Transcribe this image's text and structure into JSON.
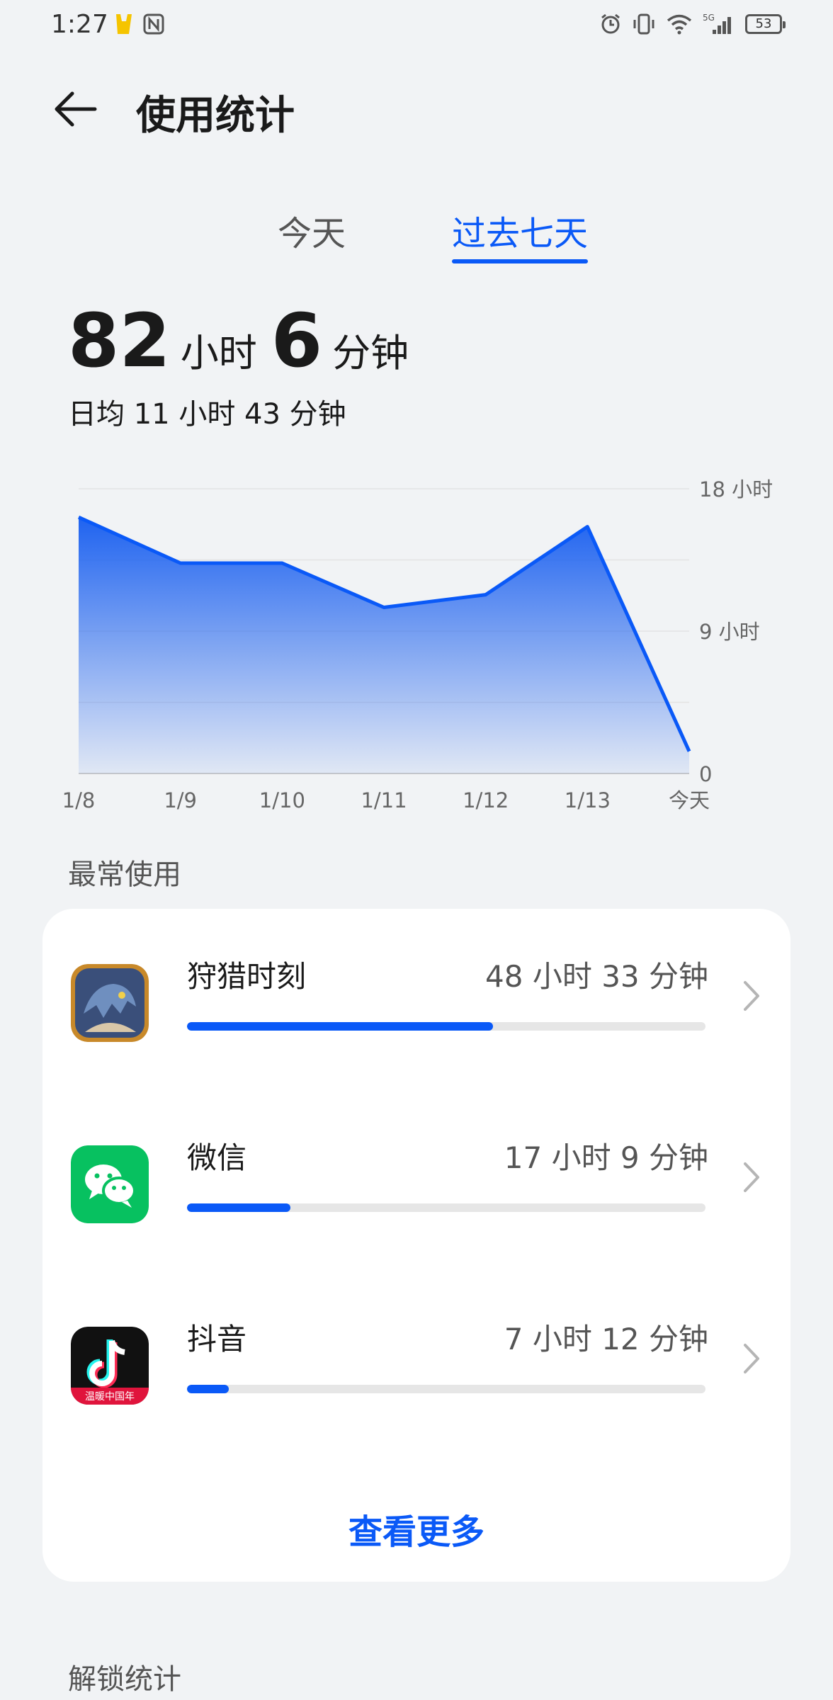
{
  "status_bar": {
    "time": "1:27",
    "battery": "53",
    "network": "5G"
  },
  "header": {
    "title": "使用统计"
  },
  "tabs": [
    {
      "label": "今天",
      "active": false
    },
    {
      "label": "过去七天",
      "active": true
    }
  ],
  "summary": {
    "hours": "82",
    "hours_unit": "小时",
    "minutes": "6",
    "minutes_unit": "分钟",
    "daily_avg": "日均 11 小时 43 分钟"
  },
  "chart_data": {
    "type": "area",
    "x": [
      "1/8",
      "1/9",
      "1/10",
      "1/11",
      "1/12",
      "1/13",
      "今天"
    ],
    "values": [
      16.2,
      13.3,
      13.3,
      10.5,
      11.3,
      15.6,
      1.4
    ],
    "y_unit": "小时",
    "ylim": [
      0,
      18
    ],
    "y_ticks": [
      "0",
      "9 小时",
      "18 小时"
    ],
    "grid": true,
    "color": "#0a59f7"
  },
  "most_used": {
    "label": "最常使用",
    "apps": [
      {
        "name": "狩猎时刻",
        "time": "48 小时 33 分钟",
        "fraction": 0.59,
        "icon": "game-app-icon"
      },
      {
        "name": "微信",
        "time": "17 小时 9 分钟",
        "fraction": 0.2,
        "icon": "wechat-icon"
      },
      {
        "name": "抖音",
        "time": "7 小时 12 分钟",
        "fraction": 0.08,
        "icon": "douyin-icon",
        "icon_caption": "温暖中国年"
      }
    ],
    "more_label": "查看更多"
  },
  "unlock": {
    "label": "解锁统计"
  },
  "colors": {
    "accent": "#0a59f7",
    "background": "#f1f3f5",
    "card": "#ffffff"
  }
}
